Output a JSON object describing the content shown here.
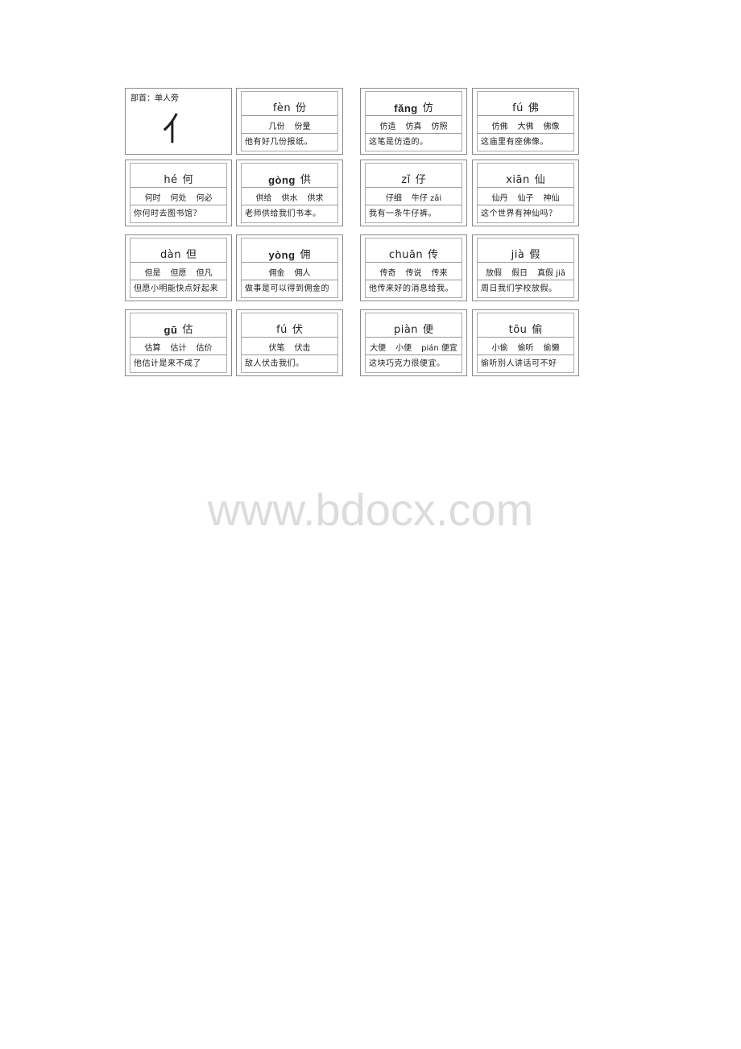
{
  "radical_card": {
    "label": "部首：单人旁",
    "glyph": "亻"
  },
  "cards": [
    {
      "pinyin": "fèn",
      "bold": false,
      "char": "份",
      "words": [
        "几份",
        "份量"
      ],
      "sentence": "他有好几份报纸。"
    },
    {
      "pinyin": "fǎng",
      "bold": true,
      "char": "仿",
      "words": [
        "仿造",
        "仿真",
        "仿照"
      ],
      "sentence": "这笔是仿造的。"
    },
    {
      "pinyin": "fú",
      "bold": false,
      "char": "佛",
      "words": [
        "仿佛",
        "大佛",
        "佛像"
      ],
      "sentence": "这庙里有座佛像。"
    },
    {
      "pinyin": "hé",
      "bold": false,
      "char": "何",
      "words": [
        "何时",
        "何处",
        "何必"
      ],
      "sentence": "你何时去图书馆？"
    },
    {
      "pinyin": "gòng",
      "bold": true,
      "char": "供",
      "words": [
        "供给",
        "供水",
        "供求"
      ],
      "sentence": "老师供给我们书本。"
    },
    {
      "pinyin": "zǐ",
      "bold": false,
      "char": "仔",
      "words": [
        "仔细",
        "牛仔 zǎi"
      ],
      "sentence": "我有一条牛仔裤。"
    },
    {
      "pinyin": "xiān",
      "bold": false,
      "char": "仙",
      "words": [
        "仙丹",
        "仙子",
        "神仙"
      ],
      "sentence": "这个世界有神仙吗？"
    },
    {
      "pinyin": "dàn",
      "bold": false,
      "char": "但",
      "words": [
        "但是",
        "但愿",
        "但凡"
      ],
      "sentence": "但愿小明能快点好起来"
    },
    {
      "pinyin": "yòng",
      "bold": true,
      "char": "佣",
      "words": [
        "佣金",
        "佣人"
      ],
      "sentence": "做事是可以得到佣金的"
    },
    {
      "pinyin": "chuān",
      "bold": false,
      "char": "传",
      "words": [
        "传奇",
        "传说",
        "传来"
      ],
      "sentence": "他传来好的消息给我。"
    },
    {
      "pinyin": "jià",
      "bold": false,
      "char": "假",
      "words": [
        "放假",
        "假日",
        "真假 jiǎ"
      ],
      "sentence": "周日我们学校放假。"
    },
    {
      "pinyin": "gū",
      "bold": true,
      "char": "估",
      "words": [
        "估算",
        "估计",
        "估价"
      ],
      "sentence": "他估计是来不成了"
    },
    {
      "pinyin": "fú",
      "bold": false,
      "char": "伏",
      "words": [
        "伏笔",
        "伏击"
      ],
      "sentence": "敌人伏击我们。"
    },
    {
      "pinyin": "piàn",
      "bold": false,
      "char": "便",
      "words": [
        "大便",
        "小便",
        "pián 便宜"
      ],
      "sentence": "这块巧克力很便宜。"
    },
    {
      "pinyin": "tōu",
      "bold": false,
      "char": "偷",
      "words": [
        "小偷",
        "偷听",
        "偷懒"
      ],
      "sentence": "偷听别人讲话可不好"
    }
  ],
  "watermark": "www.bdocx.com"
}
